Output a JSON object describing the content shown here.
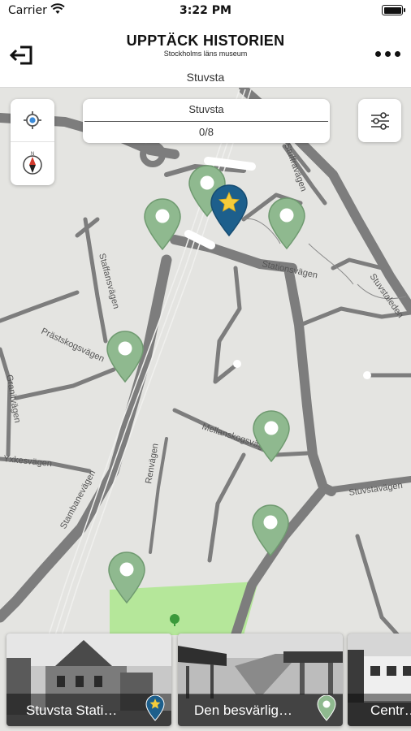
{
  "status_bar": {
    "carrier": "Carrier",
    "time": "3:22 PM"
  },
  "header": {
    "title": "UPPTÄCK HISTORIEN",
    "subtitle": "Stockholms läns museum",
    "area": "Stuvsta",
    "back_icon": "exit-arrow-icon",
    "more_icon": "more-dots-icon"
  },
  "map": {
    "search": {
      "place": "Stuvsta",
      "progress": "0/8"
    },
    "street_labels": [
      "Stationsvägen",
      "Stuvstaleden",
      "Stuvstavägen",
      "Staffansvägen",
      "Prästskogsvägen",
      "Granitvägen",
      "Yxkesvägen",
      "Stambanevägen",
      "Renvägen",
      "Mellanskogsvägen",
      "Stuffravägen"
    ],
    "colors": {
      "pin_green": "#8fb98f",
      "pin_blue": "#1d5f8c",
      "star": "#f5cc3a",
      "park": "#b5e79a",
      "road": "#7d7d7d"
    }
  },
  "cards": [
    {
      "label": "Stuvsta Stati…",
      "badge": "star-pin"
    },
    {
      "label": "Den besvärlig…",
      "badge": "green-pin"
    },
    {
      "label": "Centr…",
      "badge": ""
    }
  ]
}
